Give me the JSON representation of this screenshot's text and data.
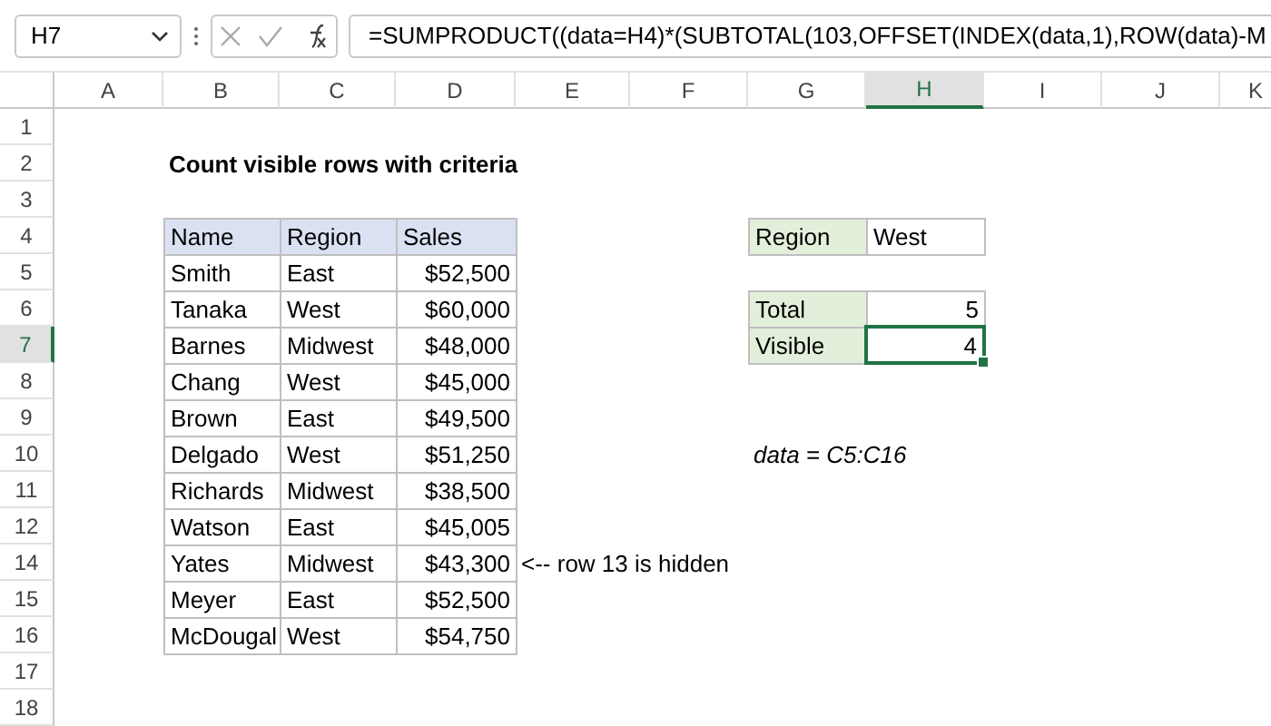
{
  "name_box": "H7",
  "formula": "=SUMPRODUCT((data=H4)*(SUBTOTAL(103,OFFSET(INDEX(data,1),ROW(data)-M",
  "columns": [
    {
      "label": "A",
      "selected": false
    },
    {
      "label": "B",
      "selected": false
    },
    {
      "label": "C",
      "selected": false
    },
    {
      "label": "D",
      "selected": false
    },
    {
      "label": "E",
      "selected": false
    },
    {
      "label": "F",
      "selected": false
    },
    {
      "label": "G",
      "selected": false
    },
    {
      "label": "H",
      "selected": true
    },
    {
      "label": "I",
      "selected": false
    },
    {
      "label": "J",
      "selected": false
    },
    {
      "label": "K",
      "selected": false
    }
  ],
  "rows": [
    {
      "label": "1",
      "selected": false
    },
    {
      "label": "2",
      "selected": false
    },
    {
      "label": "3",
      "selected": false
    },
    {
      "label": "4",
      "selected": false
    },
    {
      "label": "5",
      "selected": false
    },
    {
      "label": "6",
      "selected": false
    },
    {
      "label": "7",
      "selected": true
    },
    {
      "label": "8",
      "selected": false
    },
    {
      "label": "9",
      "selected": false
    },
    {
      "label": "10",
      "selected": false
    },
    {
      "label": "11",
      "selected": false
    },
    {
      "label": "12",
      "selected": false
    },
    {
      "label": "14",
      "selected": false
    },
    {
      "label": "15",
      "selected": false
    },
    {
      "label": "16",
      "selected": false
    },
    {
      "label": "17",
      "selected": false
    },
    {
      "label": "18",
      "selected": false
    }
  ],
  "title": "Count visible rows with criteria",
  "table": {
    "columns": [
      "Name",
      "Region",
      "Sales"
    ],
    "rows": [
      [
        "Smith",
        "East",
        "$52,500"
      ],
      [
        "Tanaka",
        "West",
        "$60,000"
      ],
      [
        "Barnes",
        "Midwest",
        "$48,000"
      ],
      [
        "Chang",
        "West",
        "$45,000"
      ],
      [
        "Brown",
        "East",
        "$49,500"
      ],
      [
        "Delgado",
        "West",
        "$51,250"
      ],
      [
        "Richards",
        "Midwest",
        "$38,500"
      ],
      [
        "Watson",
        "East",
        "$45,005"
      ],
      [
        "Yates",
        "Midwest",
        "$43,300"
      ],
      [
        "Meyer",
        "East",
        "$52,500"
      ],
      [
        "McDougal",
        "West",
        "$54,750"
      ]
    ]
  },
  "criteria": {
    "label": "Region",
    "value": "West"
  },
  "results": [
    {
      "label": "Total",
      "value": "5",
      "selected": false
    },
    {
      "label": "Visible",
      "value": "4",
      "selected": true
    }
  ],
  "named_range_note": "data = C5:C16",
  "annotation": "<-- row 13 is hidden"
}
